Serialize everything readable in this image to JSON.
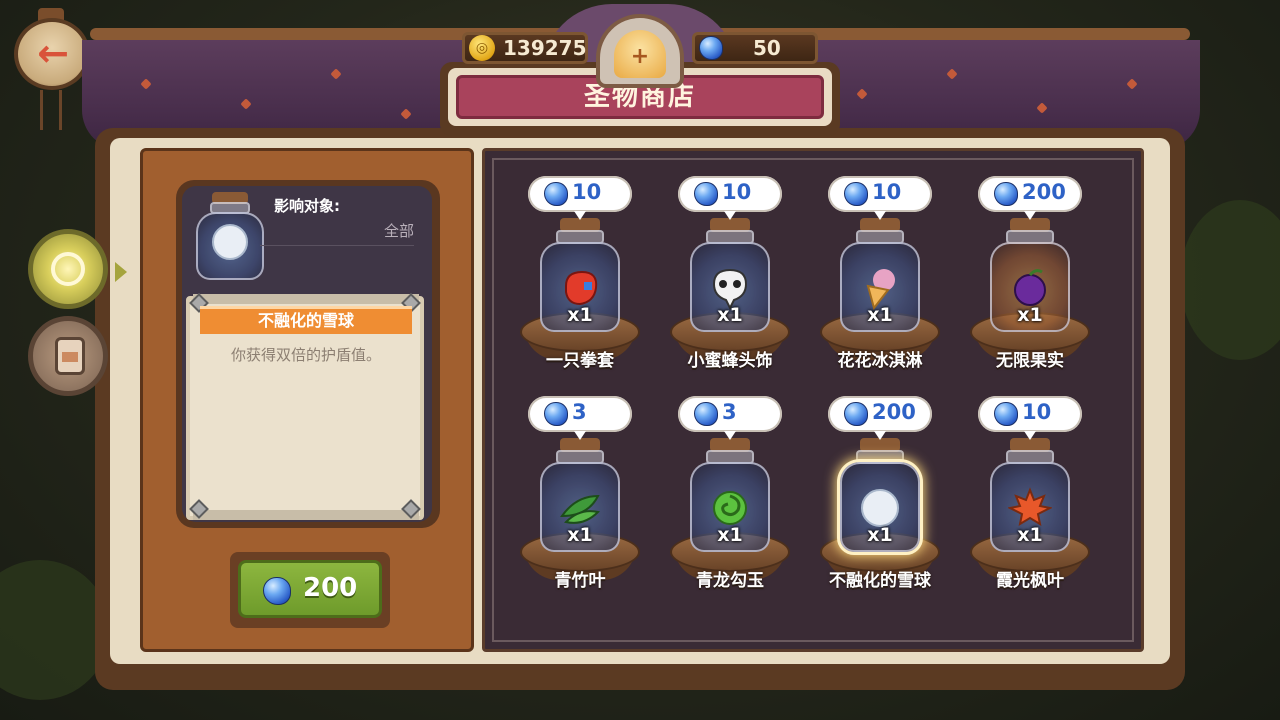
{
  "header": {
    "coins": "139275",
    "gems": "50",
    "title": "圣物商店"
  },
  "detail": {
    "target_label": "影响对象:",
    "target_value": "全部",
    "item_name": "不融化的雪球",
    "description": "你获得双倍的护盾值。",
    "buy_price": "200"
  },
  "shop": {
    "items": [
      {
        "price": "10",
        "qty": "x1",
        "name": "一只拳套",
        "icon": "boxing-glove-icon"
      },
      {
        "price": "10",
        "qty": "x1",
        "name": "小蜜蜂头饰",
        "icon": "bee-skull-icon"
      },
      {
        "price": "10",
        "qty": "x1",
        "name": "花花冰淇淋",
        "icon": "ice-cream-icon"
      },
      {
        "price": "200",
        "qty": "x1",
        "name": "无限果实",
        "icon": "purple-fruit-icon"
      },
      {
        "price": "3",
        "qty": "x1",
        "name": "青竹叶",
        "icon": "bamboo-leaf-icon"
      },
      {
        "price": "3",
        "qty": "x1",
        "name": "青龙勾玉",
        "icon": "jade-dragon-icon"
      },
      {
        "price": "200",
        "qty": "x1",
        "name": "不融化的雪球",
        "icon": "snowball-icon"
      },
      {
        "price": "10",
        "qty": "x1",
        "name": "霞光枫叶",
        "icon": "maple-leaf-icon"
      }
    ]
  },
  "colors": {
    "gem_blue": "#2e62c6",
    "buy_green": "#7aa433",
    "ribbon_orange": "#ef8d33",
    "title_band": "#a9435c"
  }
}
